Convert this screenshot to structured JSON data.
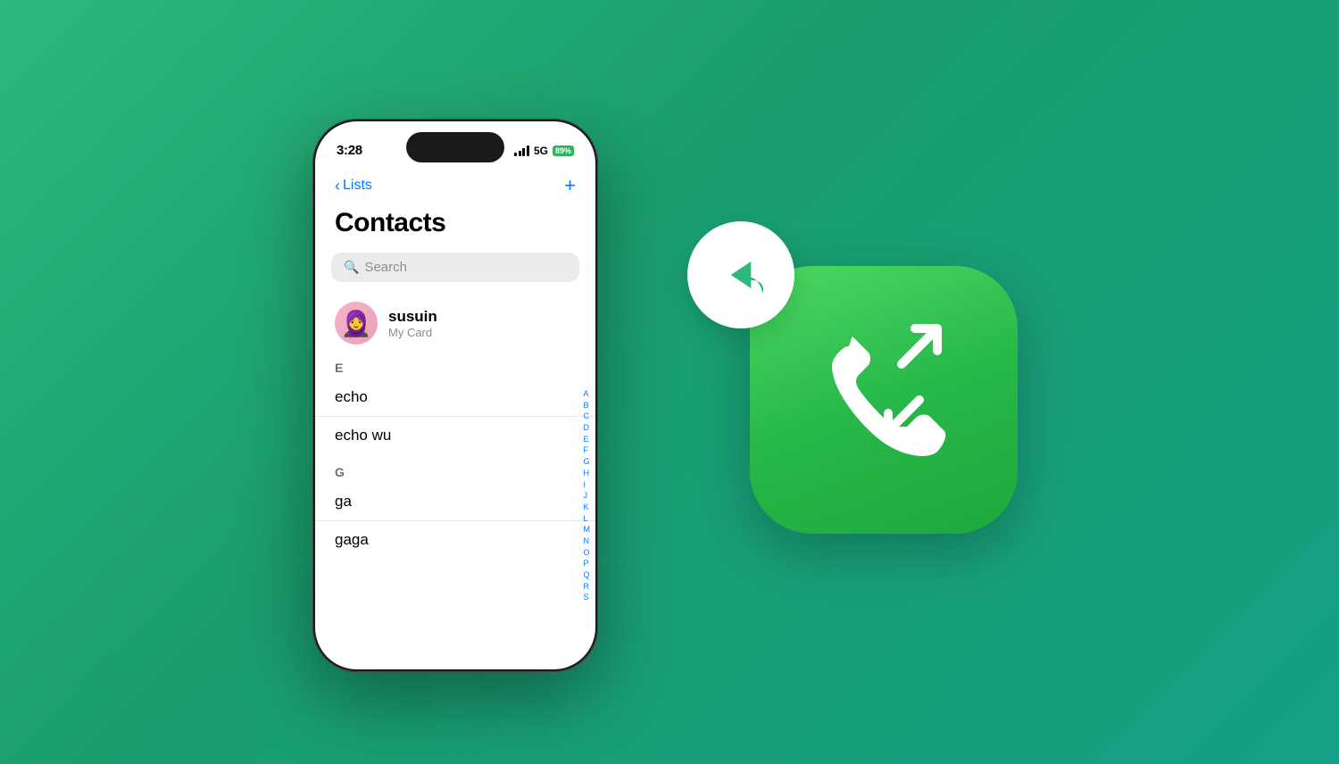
{
  "background": {
    "gradient_start": "#2db87a",
    "gradient_end": "#16a085"
  },
  "phone": {
    "status_bar": {
      "time": "3:28",
      "signal_label": "signal bars",
      "network": "5G",
      "battery_percent": "89%"
    },
    "nav": {
      "back_label": "Lists",
      "add_label": "+"
    },
    "title": "Contacts",
    "search_placeholder": "Search",
    "my_card": {
      "name": "susuin",
      "subtitle": "My Card",
      "avatar_emoji": "🧕"
    },
    "sections": [
      {
        "letter": "E",
        "contacts": [
          "echo",
          "echo wu"
        ]
      },
      {
        "letter": "G",
        "contacts": [
          "ga",
          "gaga"
        ]
      }
    ],
    "alphabet": [
      "A",
      "B",
      "C",
      "D",
      "E",
      "F",
      "G",
      "H",
      "I",
      "J",
      "K",
      "L",
      "M",
      "N",
      "O",
      "P",
      "Q",
      "R",
      "S"
    ]
  },
  "app_icon": {
    "reply_circle_label": "reply arrow",
    "phone_icon_label": "phone with arrows"
  }
}
